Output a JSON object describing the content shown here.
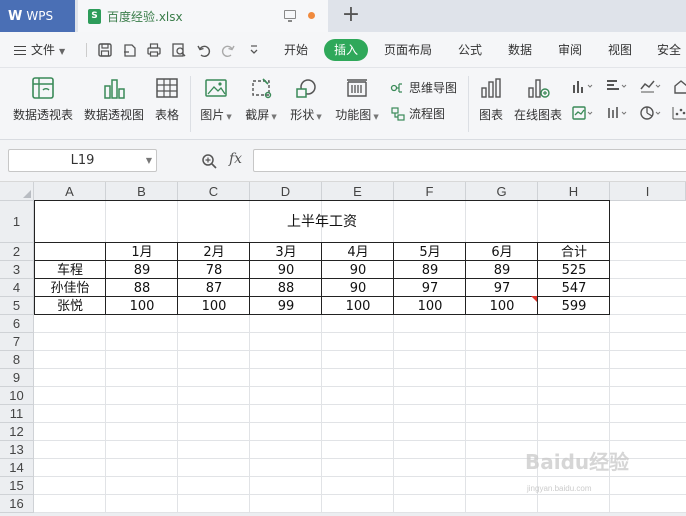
{
  "app": {
    "brand": "WPS",
    "file_tab": "百度经验.xlsx",
    "new_tab_symbol": "+"
  },
  "menu": {
    "file_label": "文件",
    "tabs": [
      "开始",
      "插入",
      "页面布局",
      "公式",
      "数据",
      "审阅",
      "视图",
      "安全"
    ],
    "active_tab": "插入"
  },
  "ribbon": {
    "pivot_table": "数据透视表",
    "pivot_chart": "数据透视图",
    "table": "表格",
    "picture": "图片",
    "screenshot": "截屏",
    "shapes": "形状",
    "function_chart": "功能图",
    "mind_map": "思维导图",
    "flowchart": "流程图",
    "chart": "图表",
    "online_chart": "在线图表"
  },
  "formula_bar": {
    "cell_ref": "L19",
    "fx_label": "fx",
    "formula": ""
  },
  "sheet": {
    "columns": [
      "A",
      "B",
      "C",
      "D",
      "E",
      "F",
      "G",
      "H",
      "I"
    ],
    "rows": [
      "1",
      "2",
      "3",
      "4",
      "5",
      "6",
      "7",
      "8",
      "9",
      "10",
      "11",
      "12",
      "13",
      "14",
      "15",
      "16"
    ],
    "title": "上半年工资",
    "header": [
      "",
      "1月",
      "2月",
      "3月",
      "4月",
      "5月",
      "6月",
      "合计"
    ],
    "data": [
      [
        "车程",
        "89",
        "78",
        "90",
        "90",
        "89",
        "89",
        "525"
      ],
      [
        "孙佳怡",
        "88",
        "87",
        "88",
        "90",
        "97",
        "97",
        "547"
      ],
      [
        "张悦",
        "100",
        "100",
        "99",
        "100",
        "100",
        "100",
        "599"
      ]
    ]
  },
  "watermark": {
    "text": "Baidu经验",
    "sub": "jingyan.baidu.com"
  },
  "colors": {
    "accent_green": "#2fa85a",
    "wps_blue": "#4a6fb5",
    "comment_red": "#d9342b"
  }
}
